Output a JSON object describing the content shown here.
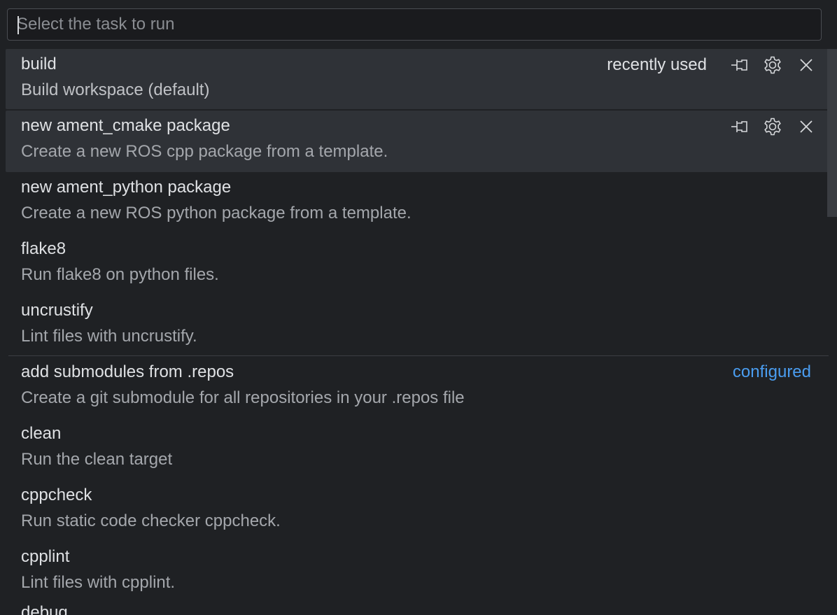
{
  "search": {
    "placeholder": "Select the task to run",
    "value": ""
  },
  "recent_group": {
    "tag": "recently used",
    "items": [
      {
        "label": "build",
        "description": "Build workspace (default)"
      },
      {
        "label": "new ament_cmake package",
        "description": "Create a new ROS cpp package from a template."
      },
      {
        "label": "new ament_python package",
        "description": "Create a new ROS python package from a template."
      },
      {
        "label": "flake8",
        "description": "Run flake8 on python files."
      },
      {
        "label": "uncrustify",
        "description": "Lint files with uncrustify."
      }
    ]
  },
  "configured_group": {
    "tag": "configured",
    "items": [
      {
        "label": "add submodules from .repos",
        "description": "Create a git submodule for all repositories in your .repos file"
      },
      {
        "label": "clean",
        "description": "Run the clean target"
      },
      {
        "label": "cppcheck",
        "description": "Run static code checker cppcheck."
      },
      {
        "label": "cpplint",
        "description": "Lint files with cpplint."
      },
      {
        "label": "debug"
      }
    ]
  },
  "icons": {
    "pin": "pin-icon",
    "configure": "gear-icon",
    "remove": "close-icon"
  },
  "colors": {
    "background": "#1f2124",
    "hover_row": "#2f3237",
    "accent": "#4a9df0"
  }
}
